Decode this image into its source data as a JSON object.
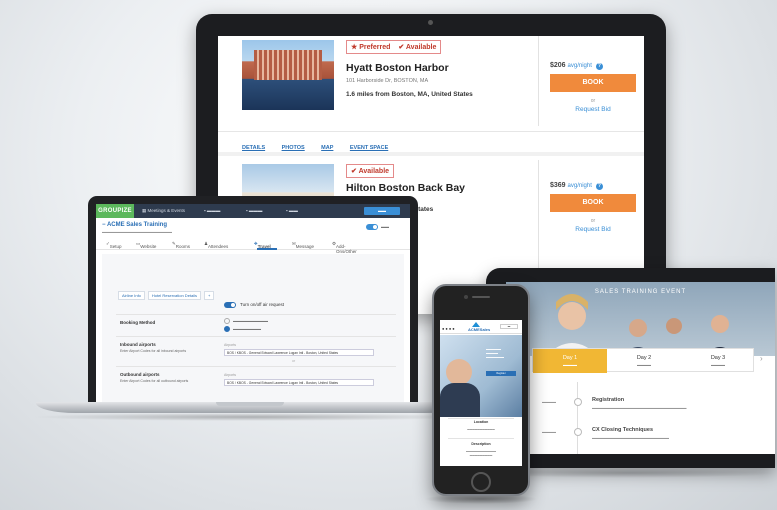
{
  "monitor": {
    "hotels": [
      {
        "badges": [
          "Preferred",
          "Available"
        ],
        "name": "Hyatt Boston Harbor",
        "address": "101 Harborside Dr, BOSTON, MA",
        "distance": "1.6 miles from Boston, MA, United States",
        "price": "$206",
        "per_night": "avg/night",
        "book_label": "BOOK",
        "or_label": "or",
        "request_bid_label": "Request Bid",
        "links": [
          "DETAILS",
          "PHOTOS",
          "MAP",
          "EVENT SPACE"
        ]
      },
      {
        "badges": [
          "Available"
        ],
        "name": "Hilton Boston Back Bay",
        "distance": "MA, United States",
        "price": "$369",
        "per_night": "avg/night",
        "book_label": "BOOK",
        "or_label": "or",
        "request_bid_label": "Request Bid"
      }
    ]
  },
  "laptop": {
    "logo": "GROUPIZE",
    "nav": [
      "Meetings & Events"
    ],
    "page_title": "ACME Sales Training",
    "tabs": [
      "Setup",
      "Website",
      "Rooms",
      "Attendees",
      "Travel",
      "Message",
      "Add-Ons/Other"
    ],
    "chips": [
      "Airline Info",
      "Hotel Reservation Details"
    ],
    "switch_label": "Turn on/off air request",
    "booking_method_label": "Booking Method",
    "inbound_label": "Inbound airports",
    "inbound_help": "Enter Airport Codes for all inbound airports",
    "airport_label": "Airports",
    "airport_value": "BOS / KBOS - General Edward Lawrence Logan Intl - Boston, United States",
    "outbound_label": "Outbound airports",
    "outbound_help": "Enter Airport Codes for all outbound airports",
    "or_label": "or"
  },
  "tablet": {
    "title": "SALES TRAINING EVENT",
    "days": [
      {
        "label": "Day 1"
      },
      {
        "label": "Day 2"
      },
      {
        "label": "Day 3"
      }
    ],
    "events": [
      {
        "title": "Registration"
      },
      {
        "title": "CX Closing Techniques"
      }
    ]
  },
  "phone": {
    "logo": "ACMESales",
    "hero_button": "Register",
    "section_1": "Location",
    "section_2": "Description"
  },
  "colors": {
    "accent_blue": "#2a6fb5",
    "book_orange": "#f08a3c",
    "groupize_green": "#5cb85c",
    "day_active": "#f1b734"
  }
}
